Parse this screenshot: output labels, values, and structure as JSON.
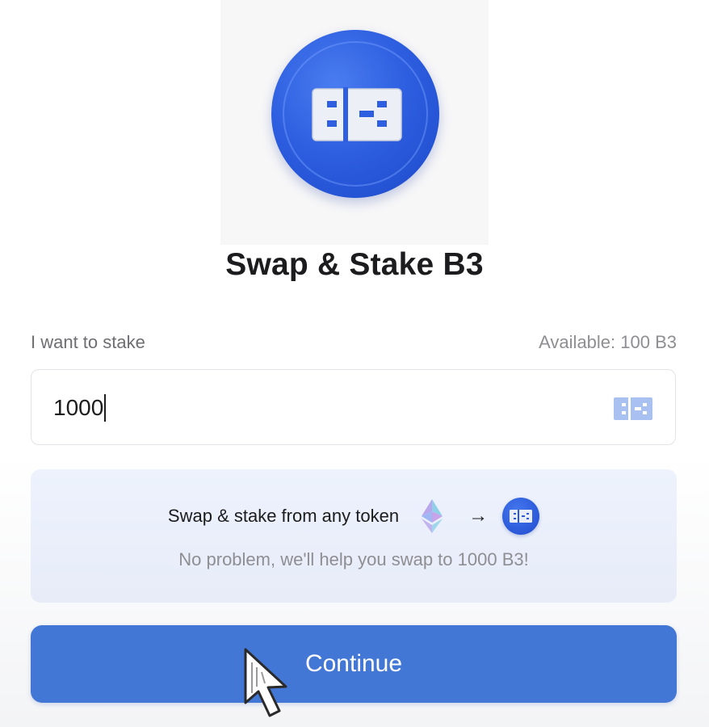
{
  "header": {
    "title": "Swap & Stake B3",
    "logo_text": "B3"
  },
  "stake": {
    "label": "I want to stake",
    "available": "Available: 100 B3",
    "amount": "1000",
    "token_icon": "b3-token-icon"
  },
  "swap_card": {
    "text": "Swap & stake from any token",
    "arrow": "→",
    "from_icon": "ethereum-icon",
    "to_icon": "b3-coin-icon",
    "subtitle": "No problem, we'll help you swap to 1000 B3!"
  },
  "actions": {
    "continue_label": "Continue"
  },
  "colors": {
    "accent": "#4377d6",
    "coin_blue": "#2e5fe0",
    "card_bg": "#edf2fd"
  }
}
